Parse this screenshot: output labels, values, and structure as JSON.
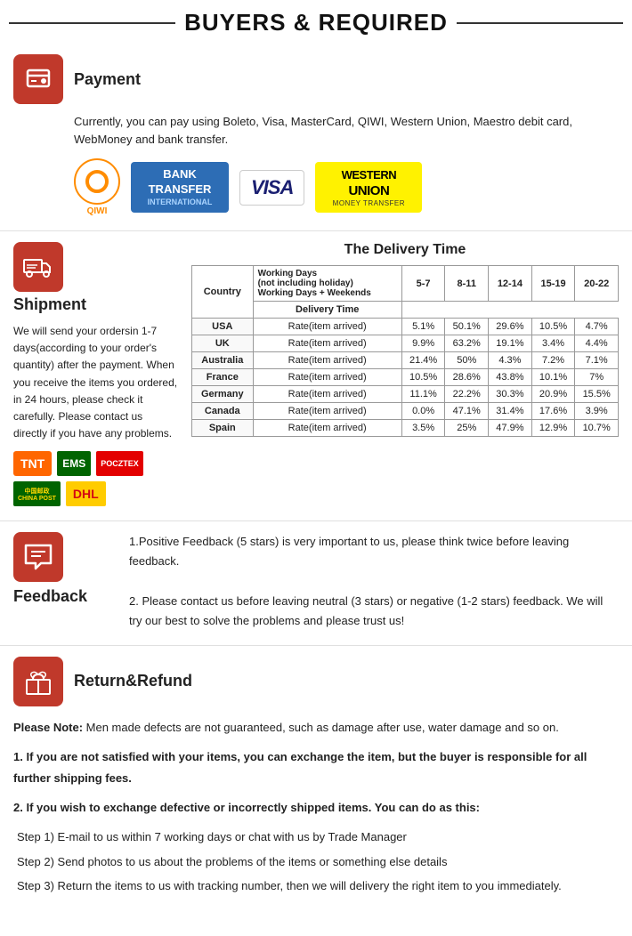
{
  "header": {
    "title": "BUYERS & REQUIRED"
  },
  "payment": {
    "section_title": "Payment",
    "description": "Currently, you can pay using Boleto, Visa, MasterCard, QIWI, Western Union, Maestro  debit card, WebMoney and bank transfer.",
    "logos": {
      "qiwi": "QIWI",
      "bank_transfer_main": "BANK TRANSFER",
      "bank_transfer_sub": "INTERNATIONAL",
      "visa": "VISA",
      "western_union_main": "WESTERN UNION",
      "western_union_sub": "MONEY TRANSFER"
    }
  },
  "shipment": {
    "section_title": "Shipment",
    "body_text": "We will send your ordersin 1-7 days(according to your order's quantity) after the payment. When you receive the items you ordered, in 24  hours, please check it carefully. Please  contact us directly if you have any problems.",
    "delivery_title": "The Delivery Time",
    "table_headers": {
      "country": "Country",
      "delivery_time": "Delivery Time",
      "working_days_label": "Working Days",
      "not_including": "(not including holiday)",
      "plus_weekends": "Working Days + Weekends",
      "col_5_7": "5-7",
      "col_8_11": "8-11",
      "col_12_14": "12-14",
      "col_15_19": "15-19",
      "col_20_22": "20-22"
    },
    "table_rows": [
      {
        "country": "USA",
        "rate_label": "Rate(item arrived)",
        "c1": "5.1%",
        "c2": "50.1%",
        "c3": "29.6%",
        "c4": "10.5%",
        "c5": "4.7%"
      },
      {
        "country": "UK",
        "rate_label": "Rate(item arrived)",
        "c1": "9.9%",
        "c2": "63.2%",
        "c3": "19.1%",
        "c4": "3.4%",
        "c5": "4.4%"
      },
      {
        "country": "Australia",
        "rate_label": "Rate(item arrived)",
        "c1": "21.4%",
        "c2": "50%",
        "c3": "4.3%",
        "c4": "7.2%",
        "c5": "7.1%"
      },
      {
        "country": "France",
        "rate_label": "Rate(item arrived)",
        "c1": "10.5%",
        "c2": "28.6%",
        "c3": "43.8%",
        "c4": "10.1%",
        "c5": "7%"
      },
      {
        "country": "Germany",
        "rate_label": "Rate(item arrived)",
        "c1": "11.1%",
        "c2": "22.2%",
        "c3": "30.3%",
        "c4": "20.9%",
        "c5": "15.5%"
      },
      {
        "country": "Canada",
        "rate_label": "Rate(item arrived)",
        "c1": "0.0%",
        "c2": "47.1%",
        "c3": "31.4%",
        "c4": "17.6%",
        "c5": "3.9%"
      },
      {
        "country": "Spain",
        "rate_label": "Rate(item arrived)",
        "c1": "3.5%",
        "c2": "25%",
        "c3": "47.9%",
        "c4": "12.9%",
        "c5": "10.7%"
      }
    ]
  },
  "feedback": {
    "section_title": "Feedback",
    "point1": "1.Positive Feedback (5 stars) is very important to us, please think twice before leaving feedback.",
    "point2": "2. Please contact us before leaving neutral (3 stars) or negative  (1-2 stars) feedback. We will try our best to solve the problems and please trust us!"
  },
  "return_refund": {
    "section_title": "Return&Refund",
    "note_label": "Please Note:",
    "note_text": " Men made defects are not guaranteed, such as damage after use, water damage and so on.",
    "point1": "1. If you are not satisfied with your items, you can exchange the item, but the buyer is responsible for all further shipping fees.",
    "point2_label": "2. If you wish to exchange defective or incorrectly shipped items. You can do as this:",
    "step1": "Step 1) E-mail to us within 7 working days or chat with us by Trade Manager",
    "step2": "Step 2) Send photos to us about the problems of the items or something else details",
    "step3": "Step 3) Return the items to us with tracking number, then we will delivery the right item to you immediately."
  }
}
